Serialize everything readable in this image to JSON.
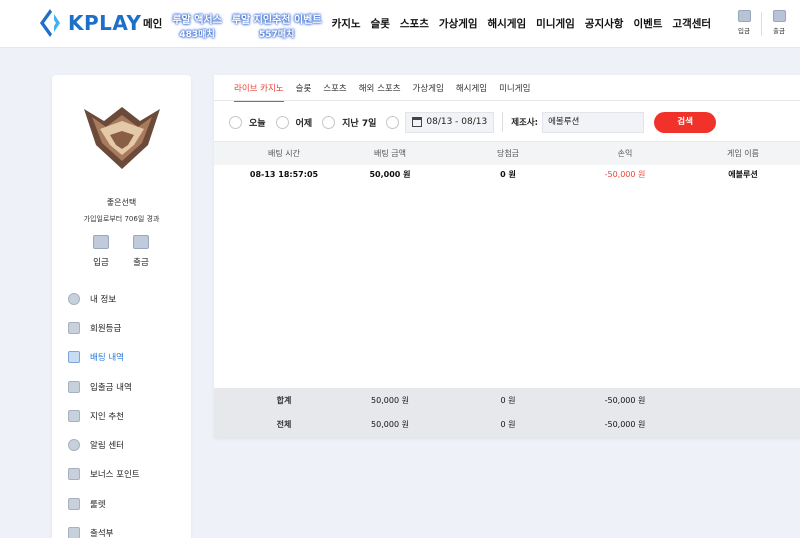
{
  "header": {
    "logo_text": "KPLAY",
    "nav": [
      {
        "label": "메인"
      },
      {
        "label": "루알 액서스",
        "sub": "483매치"
      },
      {
        "label": "루알 지인추천 이벤트",
        "sub": "557매치"
      },
      {
        "label": "카지노"
      },
      {
        "label": "슬롯"
      },
      {
        "label": "스포츠"
      },
      {
        "label": "가상게임"
      },
      {
        "label": "해시게임"
      },
      {
        "label": "미니게임"
      },
      {
        "label": "공지사항"
      },
      {
        "label": "이벤트"
      },
      {
        "label": "고객센터"
      }
    ],
    "deposit_label": "입금",
    "withdraw_label": "출금"
  },
  "sidebar": {
    "user_name": "좋은선택",
    "join_days": "가입일로부터 706일 경과",
    "deposit_label": "입금",
    "withdraw_label": "출금",
    "menu": [
      {
        "label": "내 정보",
        "icon": "user-icon"
      },
      {
        "label": "회원등급",
        "icon": "grade-icon"
      },
      {
        "label": "배팅 내역",
        "icon": "betting-history-icon",
        "active": true
      },
      {
        "label": "입출금 내역",
        "icon": "transaction-icon"
      },
      {
        "label": "지인 추천",
        "icon": "referral-icon"
      },
      {
        "label": "알림 센터",
        "icon": "notification-icon"
      },
      {
        "label": "보너스 포인트",
        "icon": "bonus-icon"
      },
      {
        "label": "룰렛",
        "icon": "roulette-icon"
      },
      {
        "label": "출석부",
        "icon": "attendance-icon"
      }
    ]
  },
  "tabs": [
    "라이브 카지노",
    "슬롯",
    "스포츠",
    "해외 스포츠",
    "가상게임",
    "해시게임",
    "미니게임"
  ],
  "filters": {
    "today": "오늘",
    "yesterday": "어제",
    "last7": "지난 7일",
    "date_range": "08/13 - 08/13",
    "maker_label": "제조사:",
    "maker_value": "에볼루션",
    "search_label": "검색"
  },
  "table": {
    "headers": [
      "배팅 시간",
      "배팅 금액",
      "당첨금",
      "손익",
      "게임 이름"
    ],
    "rows": [
      {
        "time": "08-13 18:57:05",
        "amount": "50,000 원",
        "win": "0 원",
        "profit": "-50,000 원",
        "game": "에볼루션"
      }
    ],
    "summary": [
      {
        "label": "합계",
        "amount": "50,000 원",
        "win": "0 원",
        "profit": "-50,000 원"
      },
      {
        "label": "전체",
        "amount": "50,000 원",
        "win": "0 원",
        "profit": "-50,000 원"
      }
    ]
  },
  "colors": {
    "accent": "#e8433a",
    "active_menu": "#2b7bd8",
    "logo": "#1d6fc8"
  }
}
